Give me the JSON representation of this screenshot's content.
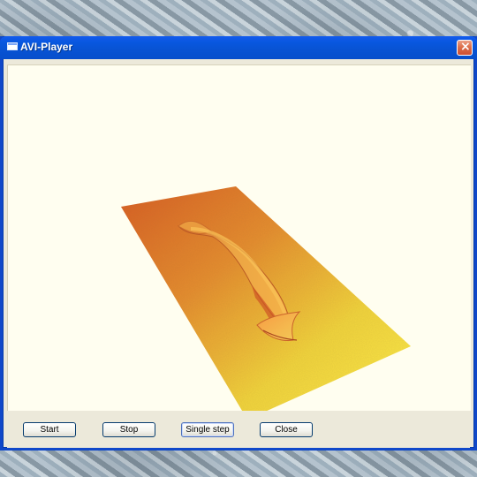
{
  "window": {
    "title": "AVI-Player"
  },
  "buttons": {
    "start": "Start",
    "stop": "Stop",
    "single_step": "Single step",
    "close": "Close"
  },
  "icons": {
    "app": "window-icon",
    "close": "close-icon"
  },
  "colors": {
    "titlebar": "#0054e3",
    "window_border": "#0a48d8",
    "client_background": "#fffeee",
    "button_bar": "#ece9d8",
    "surface_top": "#e25a1c",
    "surface_middle": "#f1b321",
    "surface_bottom": "#fff13a"
  }
}
